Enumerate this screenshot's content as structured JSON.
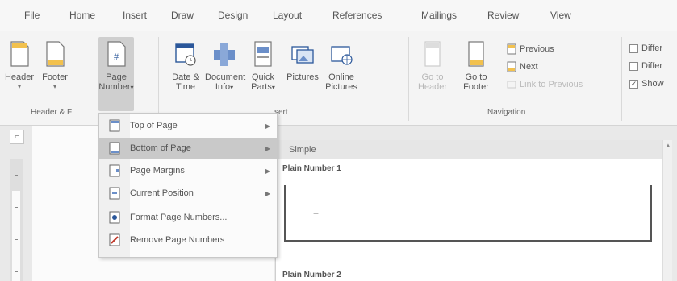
{
  "tabs": [
    "File",
    "Home",
    "Insert",
    "Draw",
    "Design",
    "Layout",
    "References",
    "Mailings",
    "Review",
    "View"
  ],
  "ribbon": {
    "header": {
      "label": "Header"
    },
    "footer": {
      "label": "Footer"
    },
    "page_number": {
      "line1": "Page",
      "line2": "Number"
    },
    "group_hf": "Header & F",
    "date_time": {
      "line1": "Date &",
      "line2": "Time"
    },
    "document_info": {
      "line1": "Document",
      "line2": "Info"
    },
    "quick_parts": {
      "line1": "Quick",
      "line2": "Parts"
    },
    "pictures": {
      "line1": "Pictures"
    },
    "online_pictures": {
      "line1": "Online",
      "line2": "Pictures"
    },
    "group_insert": "sert",
    "go_to_header": {
      "line1": "Go to",
      "line2": "Header"
    },
    "go_to_footer": {
      "line1": "Go to",
      "line2": "Footer"
    },
    "previous": "Previous",
    "next": "Next",
    "link_to_previous": "Link to Previous",
    "group_navigation": "Navigation",
    "options": [
      "Differ",
      "Differ",
      "Show"
    ]
  },
  "menu": {
    "items": [
      {
        "label": "Top of Page",
        "submenu": true
      },
      {
        "label": "Bottom of Page",
        "submenu": true
      },
      {
        "label": "Page Margins",
        "submenu": true
      },
      {
        "label": "Current Position",
        "submenu": true
      },
      {
        "label": "Format Page Numbers...",
        "submenu": false
      },
      {
        "label": "Remove Page Numbers",
        "submenu": false
      }
    ]
  },
  "gallery": {
    "header": "Simple",
    "item1_label": "Plain Number 1",
    "item2_label": "Plain Number 2",
    "cursor_mark": "+"
  },
  "colors": {
    "accent": "#2b579a",
    "highlight": "#c9c9c9"
  }
}
